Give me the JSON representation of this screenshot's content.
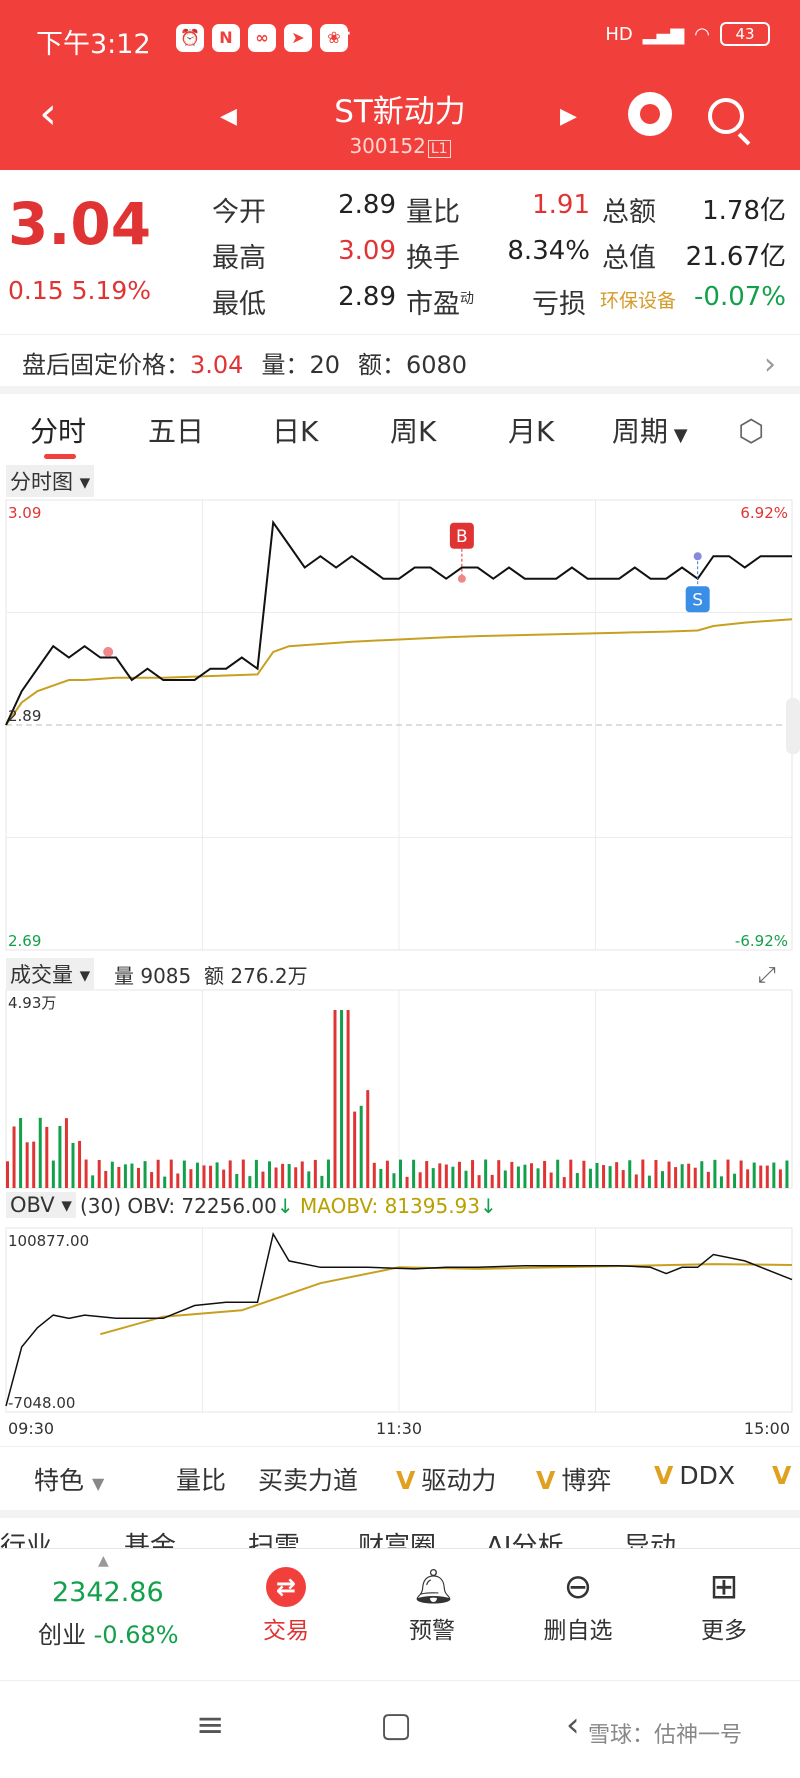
{
  "status_bar": {
    "time": "下午3:12",
    "battery": "43",
    "network": "HD"
  },
  "header": {
    "title": "ST新动力",
    "code": "300152",
    "code_badge": "L1"
  },
  "quote": {
    "price": "3.04",
    "change": "0.15",
    "change_pct": "5.19%",
    "rows": [
      [
        {
          "label": "今开",
          "value": "2.89"
        },
        {
          "label": "量比",
          "value": "1.91"
        },
        {
          "label": "总额",
          "value": "1.78亿"
        }
      ],
      [
        {
          "label": "最高",
          "value": "3.09"
        },
        {
          "label": "换手",
          "value": "8.34%"
        },
        {
          "label": "总值",
          "value": "21.67亿"
        }
      ],
      [
        {
          "label": "最低",
          "value": "2.89"
        },
        {
          "label": "市盈",
          "value": ""
        },
        {
          "label": "亏损",
          "value": ""
        }
      ]
    ],
    "pe_superscript": "动",
    "sector": "环保设备",
    "sector_change": "-0.07%"
  },
  "after_hours": {
    "label": "盘后固定价格：",
    "price": "3.04",
    "vol_label": "量：",
    "vol": "20",
    "amt_label": "额：",
    "amt": "6080"
  },
  "tabs": [
    "分时",
    "五日",
    "日K",
    "周K",
    "月K",
    "周期"
  ],
  "price_panel": {
    "label": "分时图",
    "y_top": "3.09",
    "y_mid": "2.89",
    "y_bottom": "2.69",
    "pct_top": "6.92%",
    "pct_bottom": "-6.92%",
    "buy_marker": "B",
    "sell_marker": "S"
  },
  "volume_panel": {
    "label": "成交量",
    "vol_label": "量",
    "vol": "9085",
    "amt_label": "额",
    "amt": "276.2万",
    "max": "4.93万"
  },
  "obv_panel": {
    "label": "OBV",
    "period": "(30)",
    "obv_label": "OBV: 72256.00",
    "maobv_label": "MAOBV: 81395.93",
    "max": "100877.00",
    "min": "-7048.00",
    "time_start": "09:30",
    "time_mid": "11:30",
    "time_end": "15:00"
  },
  "chart_data": {
    "type": "line",
    "title": "",
    "times": [
      "09:30",
      "11:30",
      "15:00"
    ],
    "price_range": [
      2.69,
      3.09
    ],
    "pre_close": 2.89,
    "price_series": [
      {
        "name": "",
        "x": [
          0,
          2,
          4,
          6,
          8,
          10,
          12,
          14,
          16,
          18,
          20,
          22,
          24,
          26,
          28,
          30,
          32,
          34,
          36,
          38,
          40,
          42,
          44,
          46,
          48,
          50,
          52,
          54,
          56,
          58,
          60,
          62,
          64,
          66,
          68,
          70,
          72,
          74,
          76,
          78,
          80,
          82,
          84,
          86,
          88,
          90,
          92,
          94,
          96,
          98,
          100
        ],
        "y": [
          2.89,
          2.92,
          2.94,
          2.96,
          2.95,
          2.96,
          2.95,
          2.95,
          2.93,
          2.94,
          2.93,
          2.93,
          2.93,
          2.94,
          2.94,
          2.95,
          2.94,
          3.07,
          3.05,
          3.03,
          3.04,
          3.03,
          3.04,
          3.03,
          3.02,
          3.02,
          3.03,
          3.03,
          3.02,
          3.03,
          3.03,
          3.02,
          3.03,
          3.02,
          3.02,
          3.02,
          3.03,
          3.02,
          3.02,
          3.02,
          3.03,
          3.02,
          3.02,
          3.03,
          3.02,
          3.04,
          3.04,
          3.03,
          3.04,
          3.04,
          3.04
        ]
      },
      {
        "name": "",
        "x": [
          0,
          2,
          4,
          6,
          8,
          10,
          14,
          20,
          24,
          28,
          32,
          34,
          36,
          40,
          44,
          50,
          56,
          60,
          66,
          72,
          78,
          84,
          88,
          90,
          94,
          100
        ],
        "y": [
          2.89,
          2.91,
          2.92,
          2.925,
          2.93,
          2.93,
          2.932,
          2.932,
          2.933,
          2.934,
          2.935,
          2.955,
          2.96,
          2.962,
          2.964,
          2.966,
          2.968,
          2.969,
          2.97,
          2.971,
          2.972,
          2.973,
          2.974,
          2.978,
          2.981,
          2.984
        ]
      }
    ],
    "volume": {
      "max_label": "4.93万",
      "current": 9085
    },
    "obv_series": [
      {
        "name": "OBV",
        "x": [
          0,
          2,
          4,
          6,
          8,
          10,
          14,
          20,
          24,
          28,
          32,
          34,
          36,
          40,
          46,
          52,
          56,
          60,
          66,
          72,
          78,
          82,
          84,
          86,
          88,
          90,
          94,
          100
        ],
        "y": [
          -7048,
          30000,
          42000,
          50000,
          48000,
          50000,
          48000,
          48000,
          56000,
          58000,
          58000,
          100877,
          84000,
          80000,
          80000,
          79000,
          80000,
          80000,
          81000,
          81000,
          81000,
          80000,
          76000,
          80000,
          80000,
          88000,
          84000,
          72256
        ]
      },
      {
        "name": "MAOBV",
        "x": [
          12,
          20,
          30,
          40,
          50,
          60,
          70,
          80,
          90,
          100
        ],
        "y": [
          38000,
          49000,
          53000,
          70000,
          80000,
          79000,
          80000,
          81000,
          82000,
          81395.93
        ]
      }
    ],
    "obv_range": [
      -7048,
      100877
    ]
  },
  "indicators": [
    "特色",
    "量比",
    "买卖力道",
    "驱动力",
    "博弈",
    "DDX"
  ],
  "partial_row": [
    "行业",
    "基金",
    "扫雷",
    "财富圈",
    "AI分析",
    "异动"
  ],
  "bottom_bar": {
    "index_value": "2342.86",
    "index_name": "创业",
    "index_change": "-0.68%",
    "items": [
      "交易",
      "预警",
      "删自选",
      "更多"
    ]
  },
  "watermark": "雪球：估神一号",
  "colors": {
    "brand": "#f1403c",
    "up": "#e03434",
    "down": "#13a04b",
    "avg_line": "#c8a020"
  }
}
